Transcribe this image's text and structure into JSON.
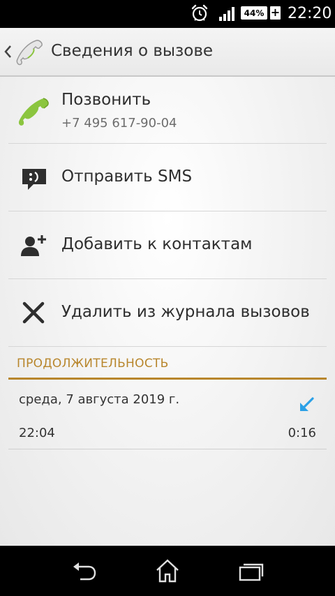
{
  "status_bar": {
    "battery_percent": "44%",
    "battery_charging": "+",
    "time": "22:20",
    "icons": [
      "alarm-icon",
      "signal-icon",
      "battery-icon"
    ]
  },
  "action_bar": {
    "title": "Сведения о вызове"
  },
  "actions": [
    {
      "label": "Позвонить",
      "sub": "+7 495 617-90-04",
      "icon": "phone-icon"
    },
    {
      "label": "Отправить SMS",
      "icon": "sms-icon"
    },
    {
      "label": "Добавить к контактам",
      "icon": "add-contact-icon"
    },
    {
      "label": "Удалить из журнала вызовов",
      "icon": "close-icon"
    }
  ],
  "duration_section": {
    "header": "ПРОДОЛЖИТЕЛЬНОСТЬ",
    "date": "среда, 7 августа 2019 г.",
    "time": "22:04",
    "duration": "0:16",
    "call_type_icon": "incoming-call-icon"
  },
  "colors": {
    "accent": "#b8862c",
    "phone_green": "#8bc53f",
    "incoming_blue": "#2ba0e6"
  }
}
